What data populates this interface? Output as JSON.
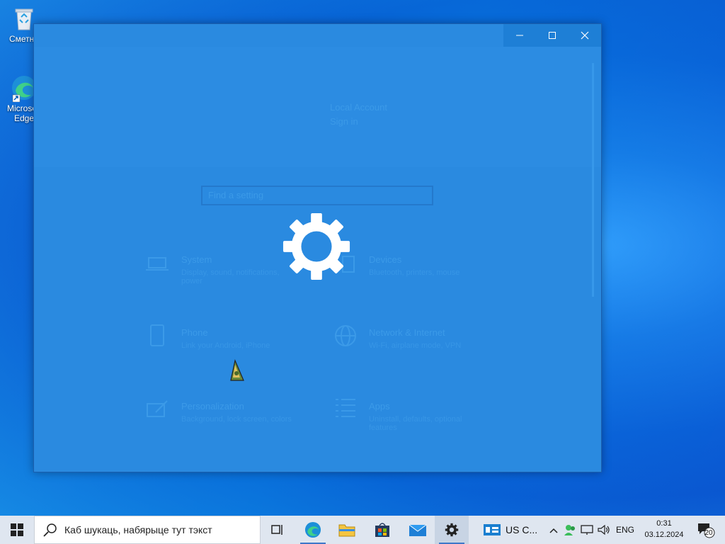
{
  "desktop": {
    "recycle_bin_label": "Сметни",
    "edge_label": "Microsoft Edge"
  },
  "settings_window": {
    "state": "loading",
    "ghost_account_line1": "Local Account",
    "ghost_account_line2": "Sign in",
    "search_placeholder": "Find a setting",
    "categories": [
      {
        "title": "System",
        "desc": "Display, sound, notifications, power"
      },
      {
        "title": "Devices",
        "desc": "Bluetooth, printers, mouse"
      },
      {
        "title": "Phone",
        "desc": "Link your Android, iPhone"
      },
      {
        "title": "Network & Internet",
        "desc": "Wi-Fi, airplane mode, VPN"
      },
      {
        "title": "Personalization",
        "desc": "Background, lock screen, colors"
      },
      {
        "title": "Apps",
        "desc": "Uninstall, defaults, optional features"
      }
    ],
    "spinner_icon": "gear-icon",
    "controls": {
      "minimize": "minimize-icon",
      "maximize": "maximize-icon",
      "close": "close-icon"
    }
  },
  "taskbar": {
    "start_icon": "windows-logo-icon",
    "search_placeholder": "Каб шукаць, набярыце тут тэкст",
    "apps": [
      {
        "name": "task-view",
        "icon": "task-view-icon"
      },
      {
        "name": "edge",
        "icon": "edge-icon"
      },
      {
        "name": "file-explorer",
        "icon": "folder-icon"
      },
      {
        "name": "store",
        "icon": "store-icon"
      },
      {
        "name": "mail",
        "icon": "mail-icon"
      },
      {
        "name": "settings",
        "icon": "gear-icon",
        "active": true
      }
    ],
    "weather_label": "US C...",
    "language": "ENG",
    "time": "0:31",
    "date": "03.12.2024",
    "notification_count": "20"
  },
  "colors": {
    "accent": "#0078d7",
    "window_overlay": "#2a8ae0",
    "taskbar": "#dfe6f0"
  }
}
